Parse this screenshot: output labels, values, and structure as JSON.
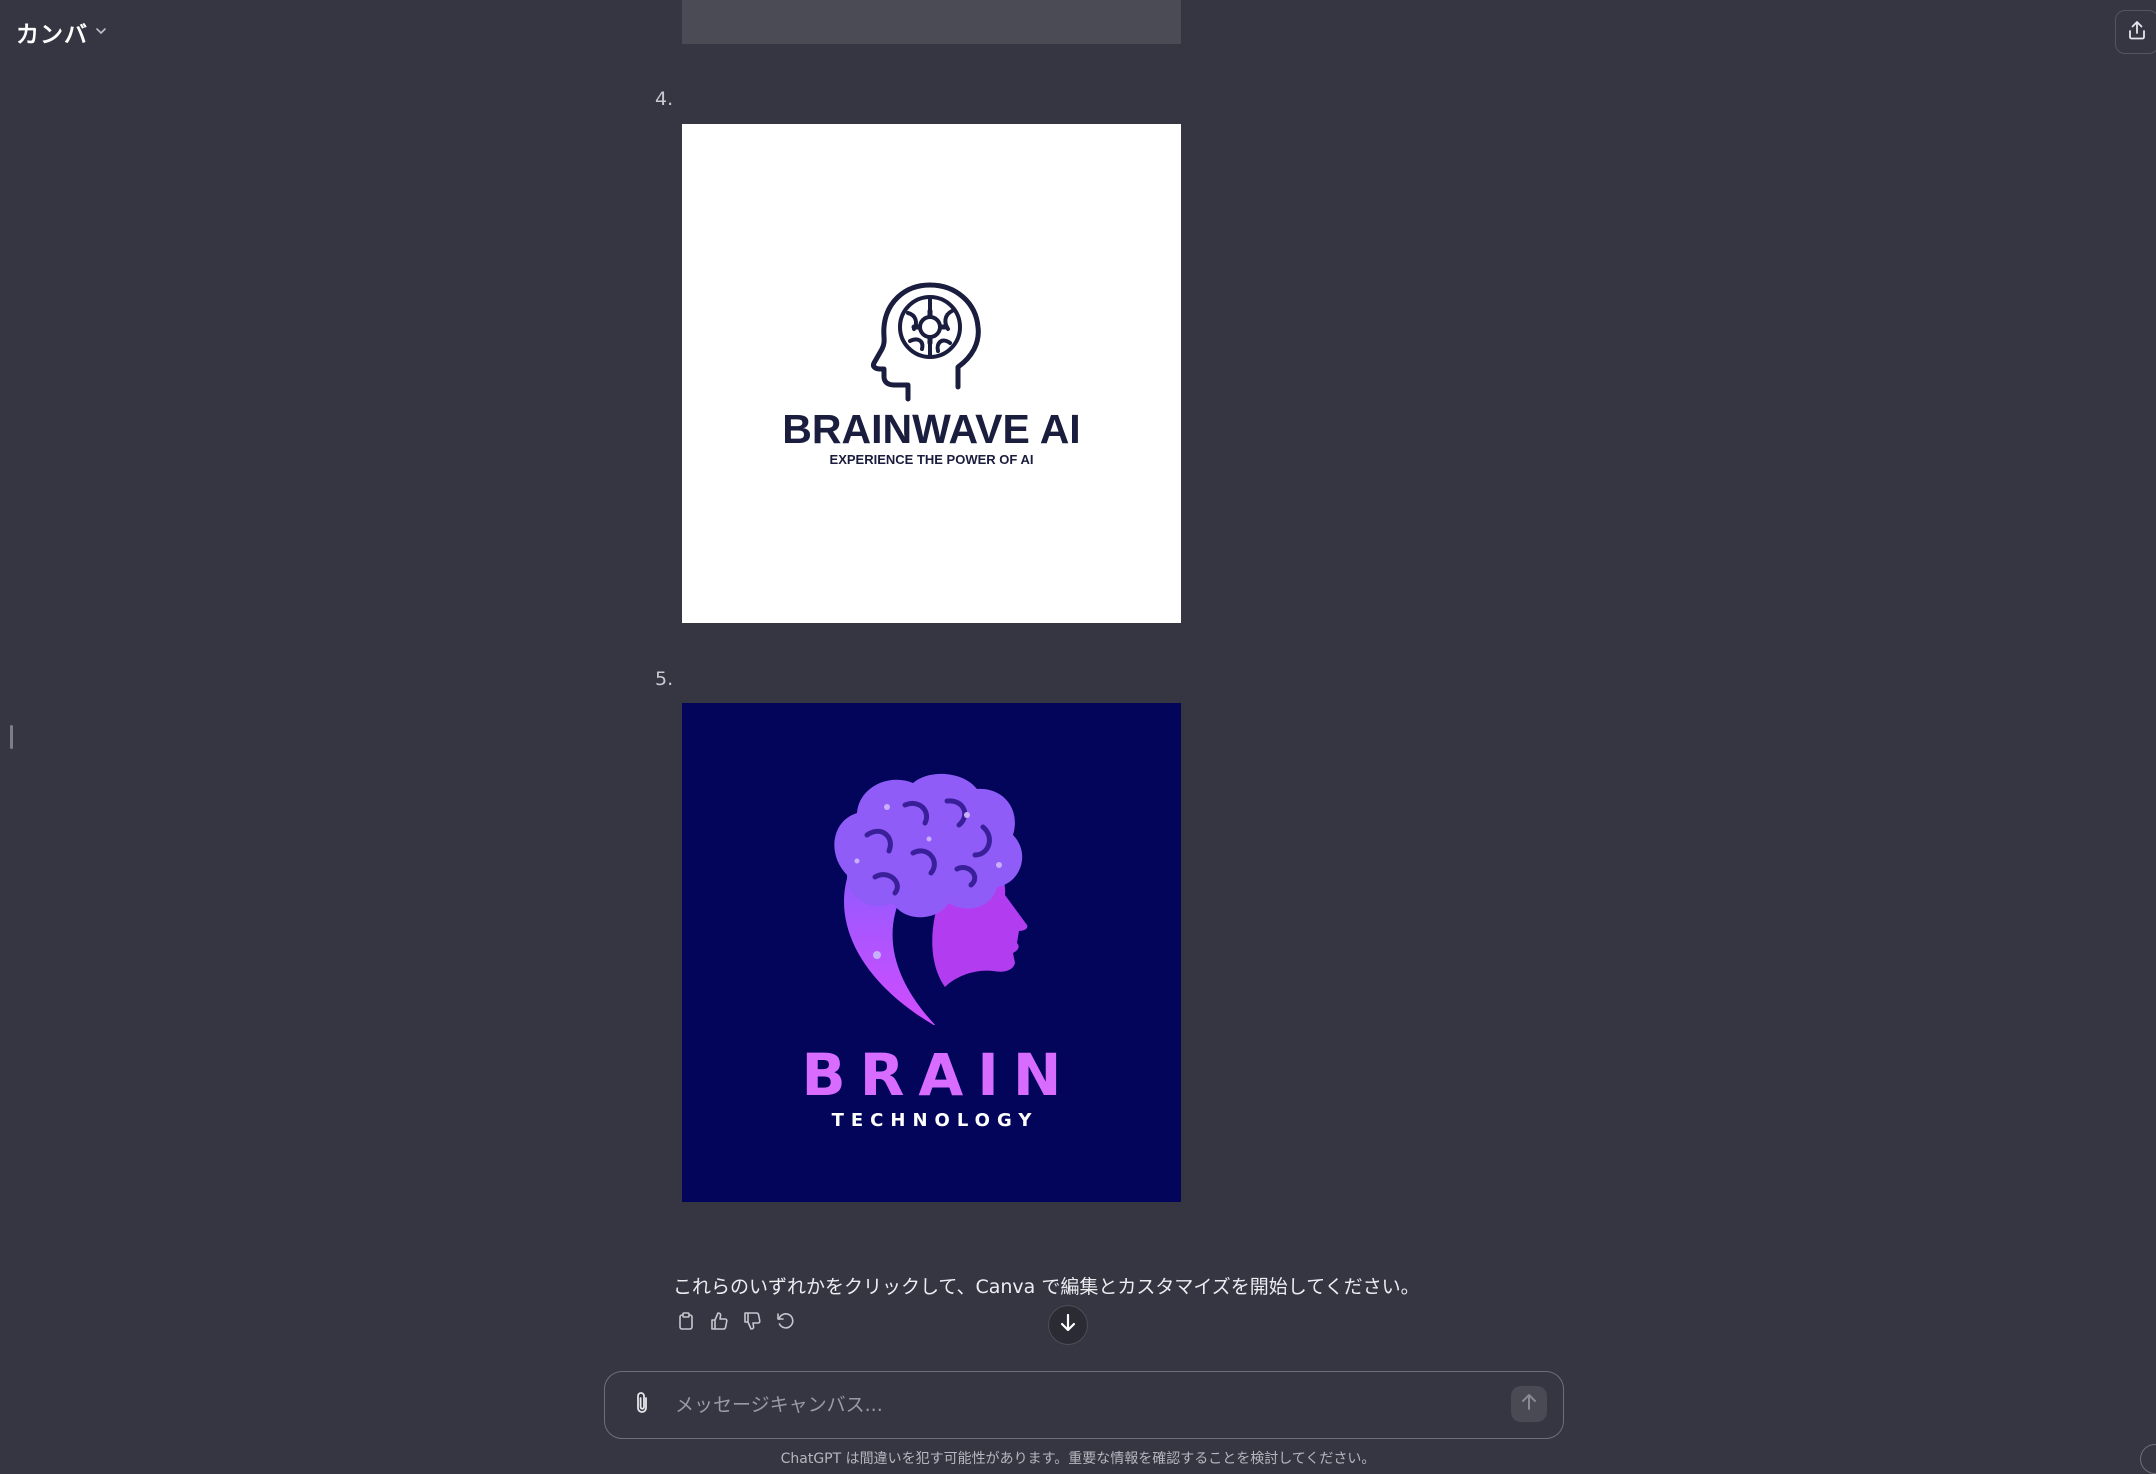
{
  "header": {
    "title": "カンバ",
    "title_dropdown_icon": "chevron-down-icon",
    "share_icon": "share-icon"
  },
  "content": {
    "items": [
      {
        "number": "4.",
        "logo": {
          "name": "BRAINWAVE AI",
          "tagline": "EXPERIENCE THE POWER OF AI",
          "background": "#ffffff",
          "ink": "#1a1d3d"
        }
      },
      {
        "number": "5.",
        "logo": {
          "name": "BRAIN",
          "tagline": "TECHNOLOGY",
          "background": "#03055a",
          "accent": "#d86cff"
        }
      }
    ],
    "message": "これらのいずれかをクリックして、Canva で編集とカスタマイズを開始してください。",
    "actions": [
      {
        "icon": "clipboard-icon",
        "label": "copy"
      },
      {
        "icon": "thumbs-up-icon",
        "label": "good response"
      },
      {
        "icon": "thumbs-down-icon",
        "label": "bad response"
      },
      {
        "icon": "refresh-icon",
        "label": "regenerate"
      }
    ]
  },
  "composer": {
    "placeholder": "メッセージキャンバス...",
    "value": "",
    "attach_icon": "paperclip-icon",
    "send_icon": "arrow-up-icon"
  },
  "footer": {
    "disclaimer": "ChatGPT は間違いを犯す可能性があります。重要な情報を確認することを検討してください。"
  }
}
